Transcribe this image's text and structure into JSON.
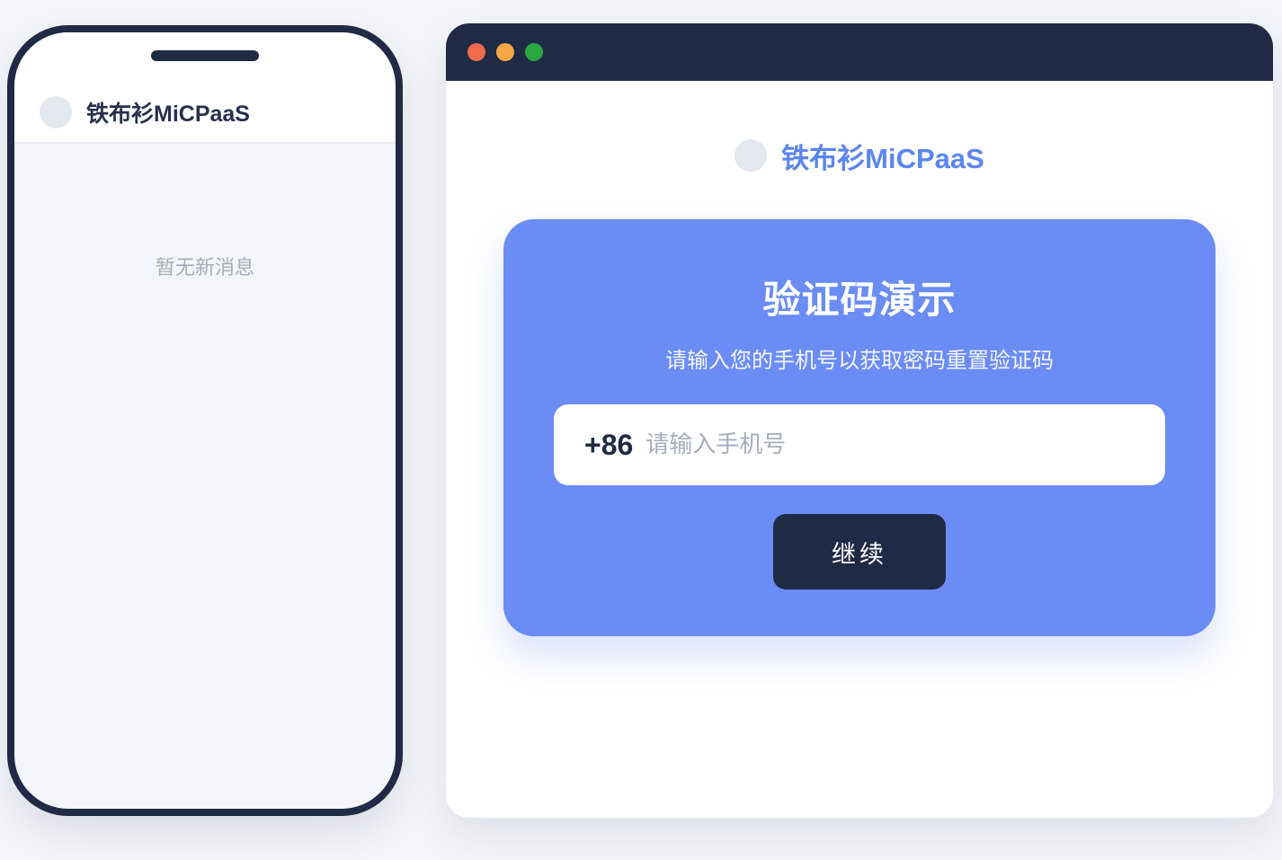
{
  "phone": {
    "brand": "铁布衫MiCPaaS",
    "empty_message": "暂无新消息"
  },
  "browser": {
    "window_dots": [
      "#ee6b4d",
      "#f3a844",
      "#2aa642"
    ],
    "brand": "铁布衫MiCPaaS",
    "card": {
      "title": "验证码演示",
      "subtitle": "请输入您的手机号以获取密码重置验证码",
      "country_code": "+86",
      "phone_value": "",
      "phone_placeholder": "请输入手机号",
      "continue_label": "继续"
    }
  },
  "colors": {
    "accent": "#6b8cf5",
    "brand_text": "#5b85f0",
    "dark": "#1f2a44"
  }
}
